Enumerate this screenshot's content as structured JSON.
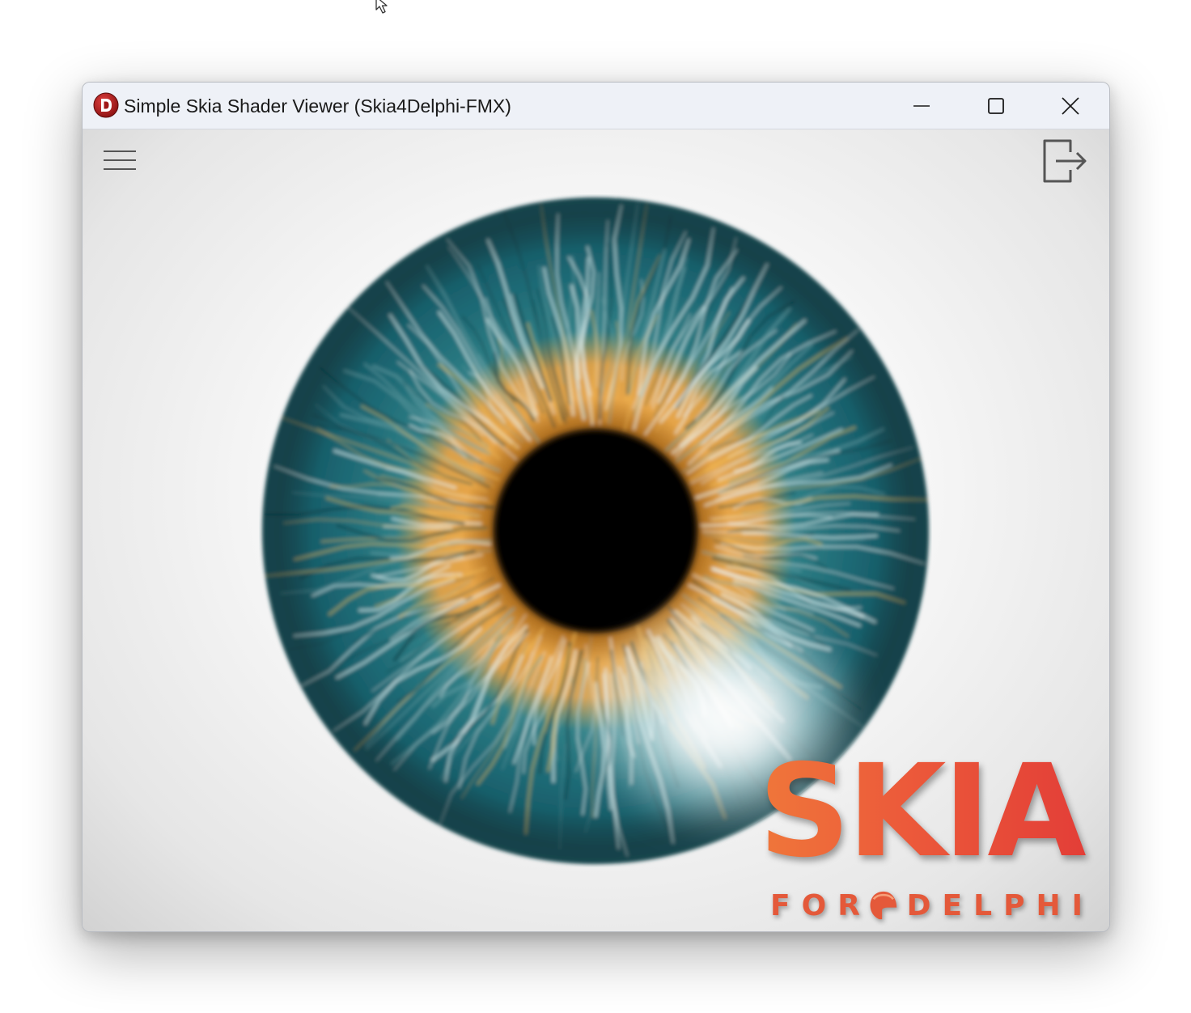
{
  "window": {
    "title": "Simple Skia Shader Viewer (Skia4Delphi-FMX)",
    "app_icon": "delphi-logo-icon",
    "controls": {
      "minimize_icon": "minimize-icon",
      "maximize_icon": "maximize-icon",
      "close_icon": "close-icon"
    }
  },
  "toolbar": {
    "menu_icon": "hamburger-menu-icon",
    "exit_icon": "exit-icon"
  },
  "shader": {
    "subject": "iris-shader-render"
  },
  "logo": {
    "word": "SKIA",
    "sub_left": "FOR",
    "sub_right": "DELPHI",
    "emblem_icon": "spartan-helmet-icon"
  },
  "colors": {
    "titlebar": "#eef1f7",
    "iris_teal": "#1e6e78",
    "iris_amber": "#e0a040",
    "pupil": "#000000",
    "logo_orange": "#f07a3a",
    "logo_red": "#e23c37"
  }
}
